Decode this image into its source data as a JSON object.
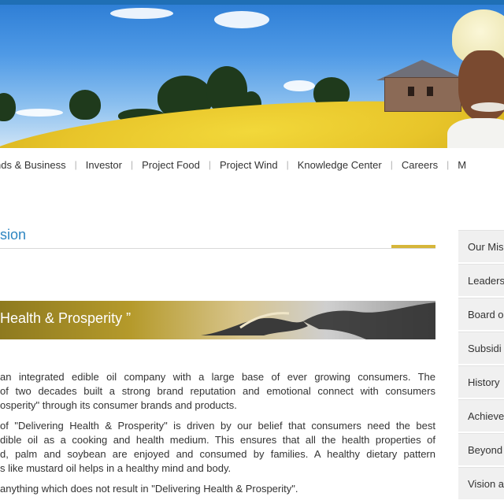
{
  "nav": {
    "items": [
      "nds & Business",
      "Investor",
      "Project Food",
      "Project Wind",
      "Knowledge Center",
      "Careers",
      "M"
    ]
  },
  "section": {
    "title": "sion"
  },
  "quote_banner": {
    "text": "Health & Prosperity ”"
  },
  "body": {
    "p1": [
      "an integrated edible oil company with a large base of ever growing consumers. The",
      " of two decades built a strong brand reputation and emotional connect with consumers",
      "osperity\" through its consumer brands and products."
    ],
    "p2": [
      "of \"Delivering Health & Prosperity\" is driven by our belief that consumers need the best",
      "dible oil as a cooking and health medium. This ensures that all the health properties of",
      "d, palm and soybean are enjoyed and consumed by families. A healthy dietary pattern",
      "s like mustard oil helps in a healthy mind and body."
    ],
    "p3": [
      "anything which does not result in \"Delivering Health & Prosperity\"."
    ]
  },
  "sidebar": {
    "items": [
      "Our Mis",
      "Leaders",
      "Board o",
      "Subsidi",
      "History",
      "Achieve",
      "Beyond",
      "Vision a"
    ]
  },
  "colors": {
    "accent": "#2e86c1",
    "gold": "#d6b63a",
    "topbar": "#1f6fb5"
  }
}
